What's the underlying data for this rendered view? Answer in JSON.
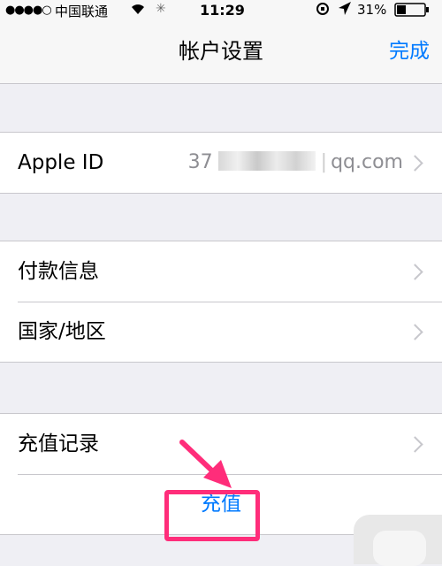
{
  "status_bar": {
    "signal": "●●●●○",
    "carrier": "中国联通",
    "wifi": "wifi-icon",
    "loading": "✳",
    "time": "11:29",
    "battery": "31%"
  },
  "nav": {
    "title": "帐户设置",
    "done": "完成"
  },
  "account": {
    "apple_id_label": "Apple ID",
    "apple_id_prefix": "37",
    "apple_id_suffix": "qq.com"
  },
  "settings": {
    "payment_label": "付款信息",
    "region_label": "国家/地区"
  },
  "recharge": {
    "history_label": "充值记录",
    "button": "充值"
  },
  "colors": {
    "accent": "#007aff",
    "highlight": "#ff2d7a"
  }
}
